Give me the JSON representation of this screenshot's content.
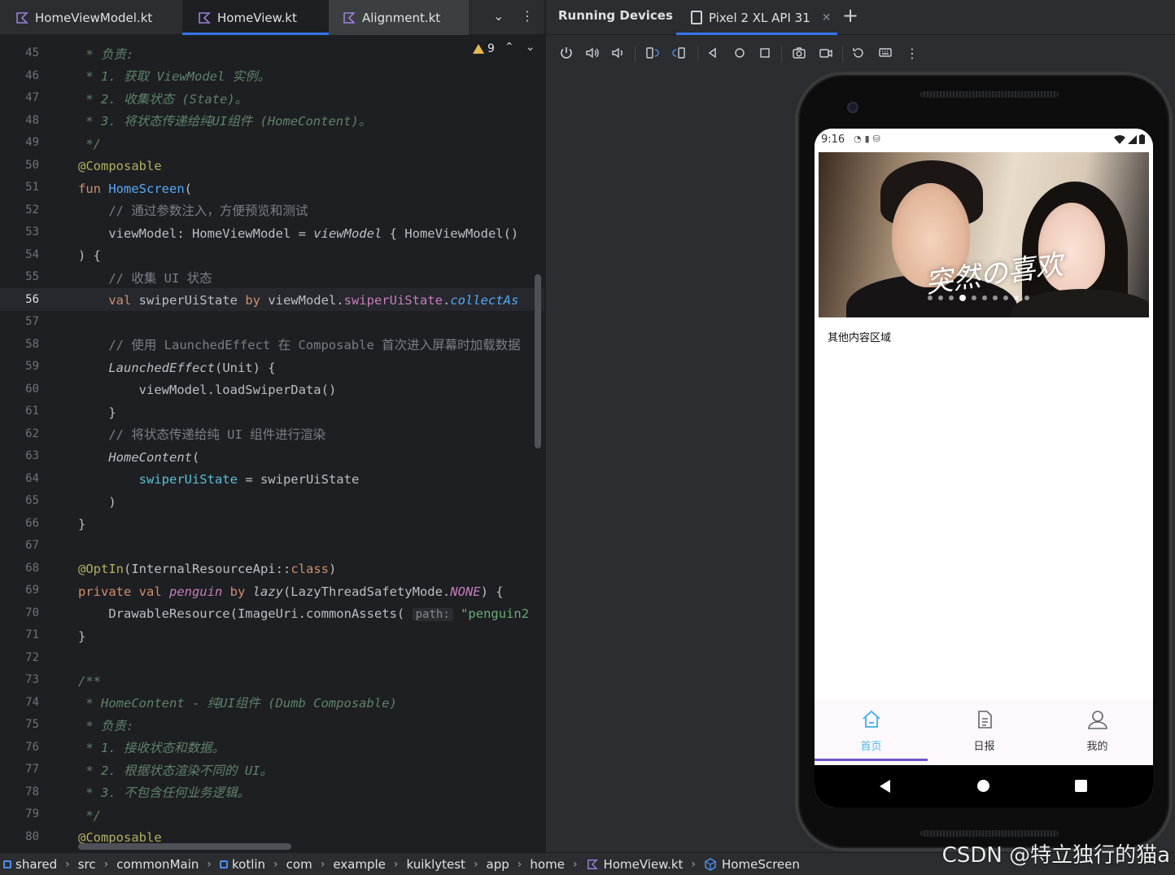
{
  "editor": {
    "tabs": [
      {
        "label": "HomeViewModel.kt"
      },
      {
        "label": "HomeView.kt"
      },
      {
        "label": "Alignment.kt"
      }
    ],
    "warnings_count": "9",
    "gutter": [
      "45",
      "46",
      "47",
      "48",
      "49",
      "50",
      "51",
      "52",
      "53",
      "54",
      "55",
      "56",
      "57",
      "58",
      "59",
      "60",
      "61",
      "62",
      "63",
      "64",
      "65",
      "66",
      "67",
      "68",
      "69",
      "70",
      "71",
      "72",
      "73",
      "74",
      "75",
      "76",
      "77",
      "78",
      "79",
      "80"
    ],
    "current_line": "56",
    "lines": {
      "l45": " * 负责:",
      "l46": " * 1. 获取 ViewModel 实例。",
      "l47": " * 2. 收集状态 (State)。",
      "l48": " * 3. 将状态传递给纯UI组件 (HomeContent)。",
      "l49": " */",
      "l50": "@Composable",
      "l51_kw": "fun ",
      "l51_fn": "HomeScreen",
      "l51_rest": "(",
      "l52": "    // 通过参数注入，方便预览和测试",
      "l53_a": "    viewModel: HomeViewModel = ",
      "l53_b": "viewModel",
      "l53_c": " { HomeViewModel()",
      "l54": ") {",
      "l55": "    // 收集 UI 状态",
      "l56_kw": "    val ",
      "l56_a": "swiperUiState ",
      "l56_by": "by ",
      "l56_b": "viewModel.",
      "l56_prop": "swiperUiState",
      "l56_dot": ".",
      "l56_call": "collectAs",
      "l58": "    // 使用 LaunchedEffect 在 Composable 首次进入屏幕时加载数据",
      "l59_a": "    ",
      "l59_fn": "LaunchedEffect",
      "l59_b": "(Unit) {",
      "l60": "        viewModel.loadSwiperData()",
      "l61": "    }",
      "l62": "    // 将状态传递给纯 UI 组件进行渲染",
      "l63_a": "    ",
      "l63_fn": "HomeContent",
      "l63_b": "(",
      "l64_a": "        ",
      "l64_param": "swiperUiState",
      "l64_b": " = swiperUiState",
      "l65": "    )",
      "l66": "}",
      "l68_ann": "@OptIn",
      "l68_b": "(InternalResourceApi::",
      "l68_kw": "class",
      "l68_c": ")",
      "l69_kw": "private val ",
      "l69_prop": "penguin",
      "l69_by": " by ",
      "l69_fn": "lazy",
      "l69_b": "(LazyThreadSafetyMode.",
      "l69_const": "NONE",
      "l69_c": ") {",
      "l70_a": "    DrawableResource(ImageUri.commonAssets( ",
      "l70_hint": "path:",
      "l70_str": " \"penguin2",
      "l71": "}",
      "l73": "/**",
      "l74": " * HomeContent - 纯UI组件 (Dumb Composable)",
      "l75": " * 负责:",
      "l76": " * 1. 接收状态和数据。",
      "l77": " * 2. 根据状态渲染不同的 UI。",
      "l78": " * 3. 不包含任何业务逻辑。",
      "l79": " */",
      "l80": "@Composable"
    }
  },
  "devices": {
    "title": "Running Devices",
    "device_tab": "Pixel 2 XL API 31",
    "toolbar_icons": [
      "power-icon",
      "volume-up-icon",
      "volume-down-icon",
      "rotate-left-icon",
      "rotate-right-icon",
      "back-icon",
      "home-icon",
      "overview-icon",
      "screenshot-icon",
      "screen-record-icon",
      "reset-icon",
      "keyboard-icon",
      "more-icon"
    ]
  },
  "app": {
    "status_time": "9:16",
    "banner_title": "突然の喜欢",
    "banner_dot_count": 10,
    "banner_active_dot": 3,
    "content_text": "其他内容区域",
    "nav": [
      {
        "label": "首页",
        "icon": "home-icon",
        "active": true
      },
      {
        "label": "日报",
        "icon": "document-icon",
        "active": false
      },
      {
        "label": "我的",
        "icon": "profile-icon",
        "active": false
      }
    ],
    "accent_color": "#4fb8e8",
    "indicator_color": "#7155c9"
  },
  "breadcrumb": [
    "shared",
    "src",
    "commonMain",
    "kotlin",
    "com",
    "example",
    "kuiklytest",
    "app",
    "home",
    "HomeView.kt",
    "HomeScreen"
  ],
  "watermark": "CSDN @特立独行的猫a"
}
